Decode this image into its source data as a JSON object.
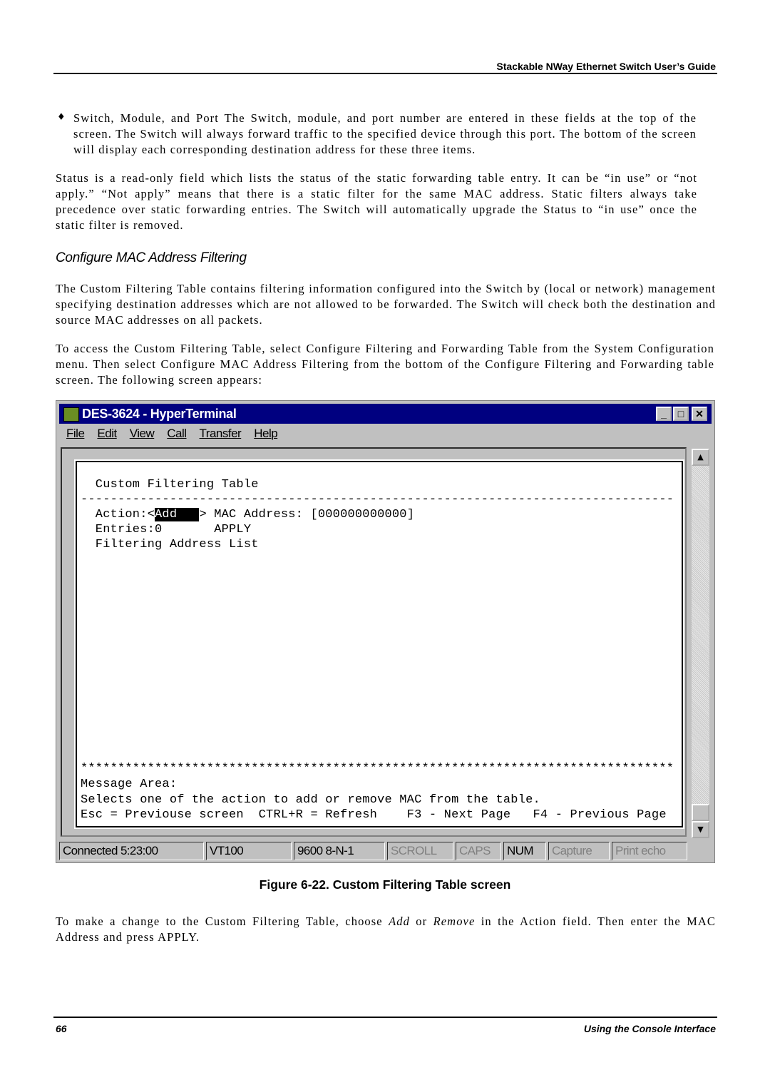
{
  "header": {
    "title": "Stackable NWay Ethernet Switch User’s Guide"
  },
  "bullet": {
    "symbol": "♦",
    "text": "Switch, Module, and Port  The Switch, module, and port number are entered in these fields at the top of the screen. The Switch will always forward traffic to the specified device through this port. The bottom of the screen will display each corresponding destination address for these three items."
  },
  "para_status": "Status is a read-only field which lists the status of the static forwarding table entry. It can be “in use” or “not apply.” “Not apply” means that there is a static filter for the same MAC address. Static filters always take precedence over static forwarding entries. The Switch will automatically upgrade the Status to “in use” once the static filter is removed.",
  "section_heading": "Configure MAC Address Filtering",
  "para_intro": "The Custom Filtering Table contains filtering information configured into the Switch by (local or network) management specifying destination addresses which are not allowed to be forwarded. The Switch will check both the destination and source MAC addresses on all packets.",
  "para_access": "To access the Custom Filtering Table, select Configure Filtering and Forwarding Table from the System Configuration menu. Then select Configure MAC Address Filtering from the bottom of the Configure Filtering and Forwarding table screen. The following screen appears:",
  "window": {
    "title": "DES-3624 - HyperTerminal",
    "title_color": "#000080",
    "buttons": {
      "minimize": "_",
      "maximize": "□",
      "close": "✕"
    },
    "menu": [
      "File",
      "Edit",
      "View",
      "Call",
      "Transfer",
      "Help"
    ],
    "terminal": {
      "title": "  Custom Filtering Table",
      "dashes": "--------------------------------------------------------------------------------",
      "action_label": "  Action:<",
      "action_value": "Add   ",
      "action_rest": "> MAC Address: [000000000000]",
      "entries": "  Entries:0       APPLY",
      "list_heading": "  Filtering Address List",
      "stars": "********************************************************************************",
      "message_label": "Message Area:",
      "message": "Selects one of the action to add or remove MAC from the table.",
      "keys": "Esc = Previouse screen  CTRL+R = Refresh    F3 - Next Page   F4 - Previous Page"
    },
    "status_bar": [
      "Connected 5:23:00",
      "VT100",
      "9600 8-N-1",
      "SCROLL",
      "CAPS",
      "NUM",
      "Capture",
      "Print echo"
    ]
  },
  "caption": "Figure 6-22.  Custom Filtering Table screen",
  "para_change": {
    "pre": "To make a change to the Custom Filtering Table, choose ",
    "add": "Add",
    "or": " or ",
    "remove": "Remove",
    "post": " in the Action field. Then enter the MAC Address and press APPLY."
  },
  "footer": {
    "page": "66",
    "section": "Using the Console Interface"
  }
}
